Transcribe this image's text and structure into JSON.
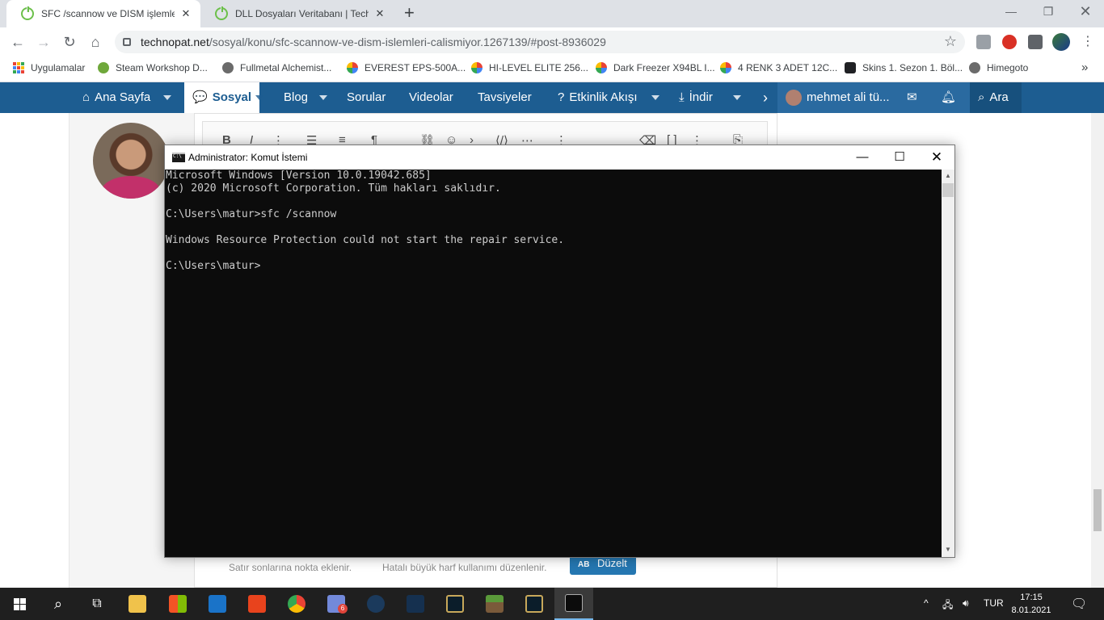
{
  "browser": {
    "tabs": [
      {
        "title": "SFC /scannow ve DISM işlemleri ç",
        "active": true
      },
      {
        "title": "DLL Dosyaları Veritabanı | Techno",
        "active": false
      }
    ],
    "url_host": "technopat.net",
    "url_path": "/sosyal/konu/sfc-scannow-ve-dism-islemleri-calismiyor.1267139/#post-8936029",
    "bookmarks": [
      "Uygulamalar",
      "Steam Workshop D...",
      "Fullmetal Alchemist...",
      "EVEREST EPS-500A...",
      "HI-LEVEL ELITE 256...",
      "Dark Freezer X94BL I...",
      "4 RENK 3 ADET 12C...",
      "Skins 1. Sezon 1. Böl...",
      "Himegoto"
    ],
    "bookmarks_overflow": "»"
  },
  "site_nav": {
    "home": "Ana Sayfa",
    "social": "Sosyal",
    "blog": "Blog",
    "questions": "Sorular",
    "videos": "Videolar",
    "recommendations": "Tavsiyeler",
    "activity": "Etkinlik Akışı",
    "download": "İndir",
    "user": "mehmet ali tü...",
    "search": "Ara"
  },
  "editor": {
    "hint_1": "Satır sonlarına nokta eklenir.",
    "hint_2": "Hatalı büyük harf kullanımı düzenlenir.",
    "fix_button": "Düzelt",
    "fix_badge": "AB"
  },
  "cmd": {
    "title": "Administrator: Komut İstemi",
    "lines": [
      "Microsoft Windows [Version 10.0.19042.685]",
      "(c) 2020 Microsoft Corporation. Tüm hakları saklıdır.",
      "",
      "C:\\Users\\matur>sfc /scannow",
      "",
      "Windows Resource Protection could not start the repair service.",
      "",
      "C:\\Users\\matur>"
    ]
  },
  "taskbar": {
    "language": "TUR",
    "time": "17:15",
    "date": "8.01.2021",
    "discord_badge": "6"
  },
  "colors": {
    "site_nav_bg": "#1d5d91",
    "console_bg": "#0c0c0c",
    "console_text": "#cccccc",
    "taskbar_bg": "#1f1f1f",
    "accent_button": "#2577b1"
  }
}
